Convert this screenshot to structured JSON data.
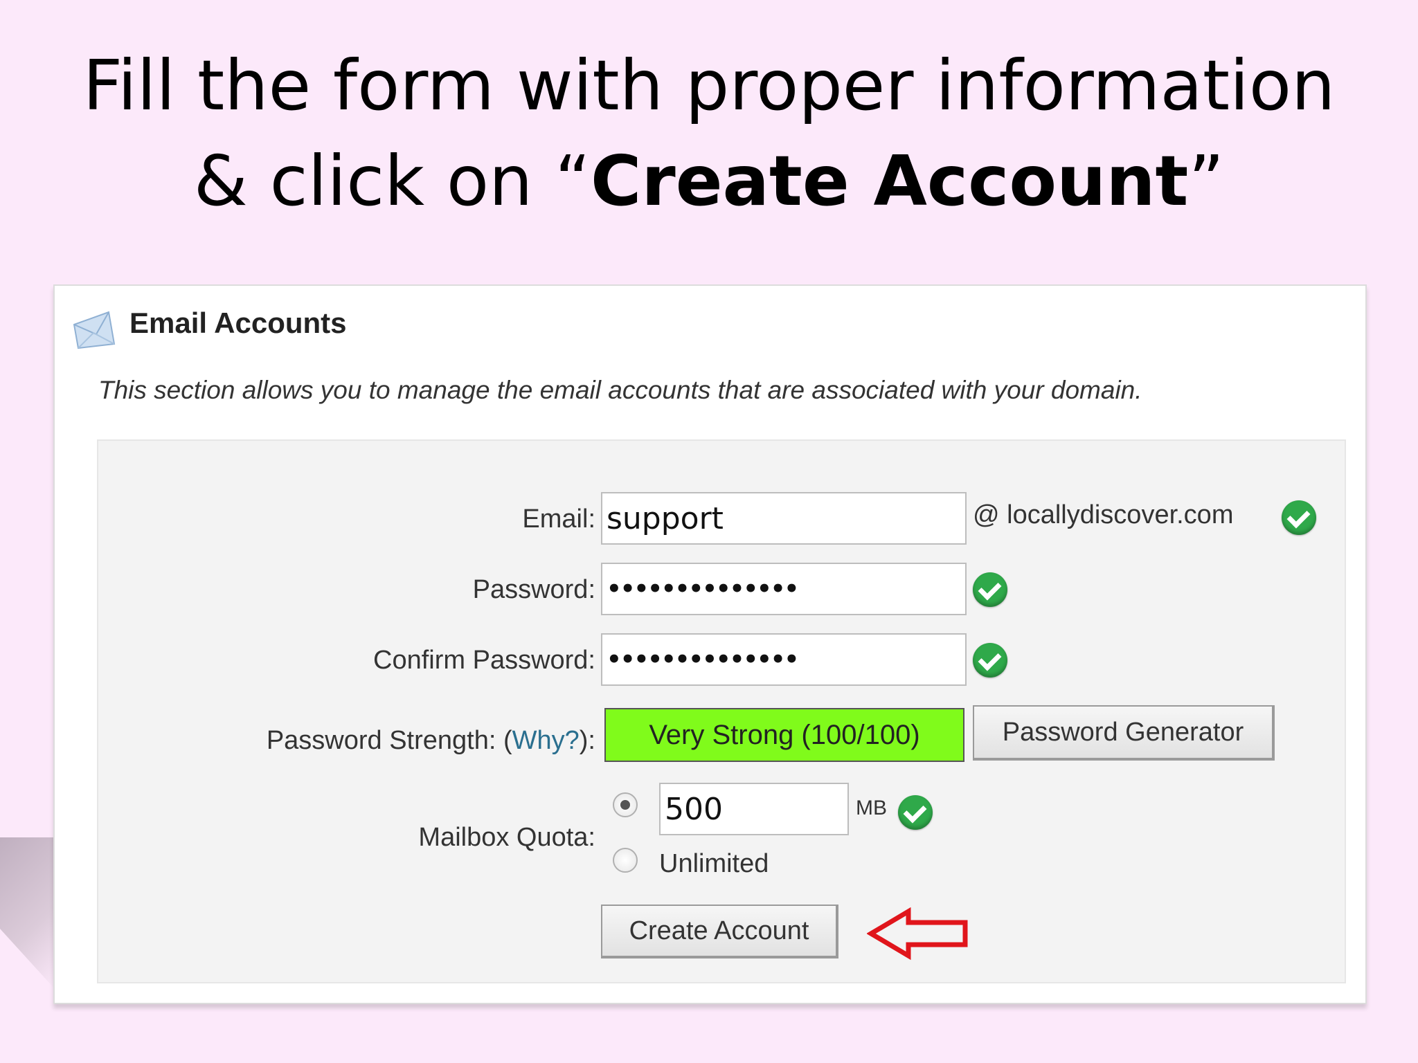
{
  "slide": {
    "title_line1": "Fill the form with proper information",
    "title_line2_prefix": "& click on “",
    "title_line2_bold": "Create Account",
    "title_line2_suffix": "”"
  },
  "panel": {
    "title": "Email Accounts",
    "description": "This section allows you to manage the email accounts that are associated with your domain."
  },
  "form": {
    "email_label": "Email:",
    "email_value": "support",
    "domain": "@ locallydiscover.com",
    "password_label": "Password:",
    "password_value": "••••••••••••••",
    "confirm_label": "Confirm Password:",
    "confirm_value": "••••••••••••••",
    "strength_label": "Password Strength: (",
    "strength_why": "Why?",
    "strength_label_end": "):",
    "strength_value": "Very Strong (100/100)",
    "generator_button": "Password Generator",
    "quota_label": "Mailbox Quota:",
    "quota_value": "500",
    "quota_unit": "MB",
    "unlimited_label": "Unlimited",
    "create_button": "Create Account"
  },
  "colors": {
    "strength_bar": "#80fb1b",
    "check": "#2fa94a",
    "arrow": "#e0151b",
    "background": "#fce9fa"
  },
  "icons": [
    "mail-icon",
    "check-icon",
    "radio-selected",
    "radio-unselected",
    "arrow-left-icon"
  ]
}
